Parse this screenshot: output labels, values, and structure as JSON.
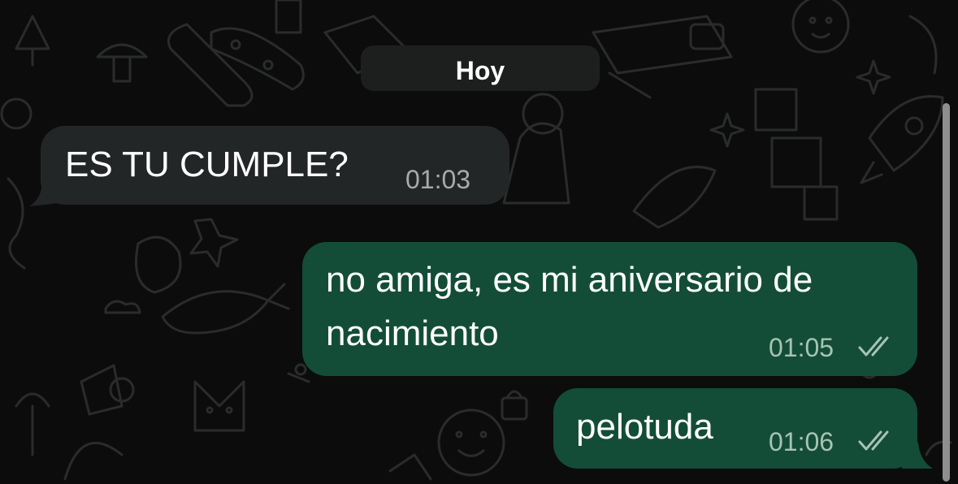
{
  "chat": {
    "date_separator": "Hoy",
    "messages": [
      {
        "direction": "incoming",
        "text": "ES TU CUMPLE?",
        "time": "01:03"
      },
      {
        "direction": "outgoing",
        "text_line1": "no amiga, es mi aniversario de",
        "text_line2": "nacimiento",
        "time": "01:05",
        "status": "read-double-check-icon"
      },
      {
        "direction": "outgoing",
        "text": "pelotuda",
        "time": "01:06",
        "status": "read-double-check-icon"
      }
    ]
  },
  "colors": {
    "background": "#0c0c0c",
    "incoming_bubble": "#232626",
    "outgoing_bubble": "#134d37",
    "date_pill": "#1d1f1f",
    "timestamp_incoming": "#a9aaa9",
    "timestamp_outgoing": "#a7c3b6"
  }
}
